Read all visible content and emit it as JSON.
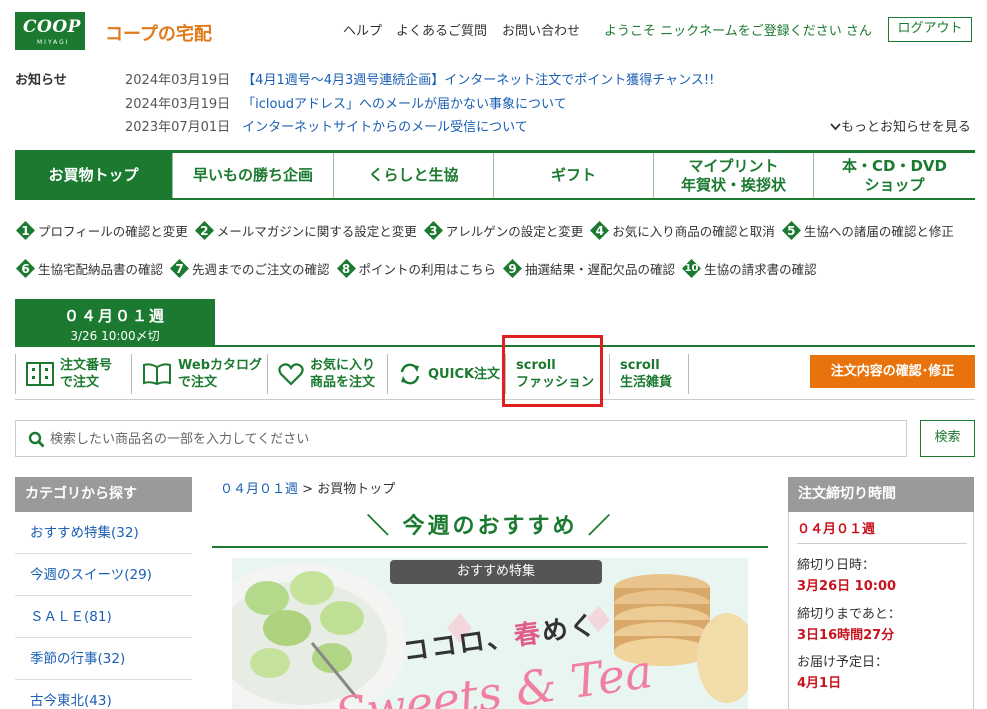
{
  "header": {
    "logo_text": "COOP",
    "logo_sub": "MIYAGI",
    "brand": "コープの宅配",
    "links": [
      "ヘルプ",
      "よくあるご質問",
      "お問い合わせ"
    ],
    "welcome": "ようこそ ニックネームをご登録ください さん",
    "logout": "ログアウト"
  },
  "news": {
    "label": "お知らせ",
    "items": [
      {
        "date": "2024年03月19日",
        "title": "【4月1週号～4月3週号連続企画】インターネット注文でポイント獲得チャンス!!"
      },
      {
        "date": "2024年03月19日",
        "title": "「icloudアドレス」へのメールが届かない事象について"
      },
      {
        "date": "2023年07月01日",
        "title": "インターネットサイトからのメール受信について"
      }
    ],
    "more": "もっとお知らせを見る"
  },
  "mainnav": [
    {
      "line1": "お買物トップ",
      "line2": ""
    },
    {
      "line1": "早いもの勝ち企画",
      "line2": ""
    },
    {
      "line1": "くらしと生協",
      "line2": ""
    },
    {
      "line1": "ギフト",
      "line2": ""
    },
    {
      "line1": "マイプリント",
      "line2": "年賀状・挨拶状"
    },
    {
      "line1": "本・CD・DVD",
      "line2": "ショップ"
    }
  ],
  "steps": [
    {
      "num": "1",
      "label": "プロフィールの確認と変更"
    },
    {
      "num": "2",
      "label": "メールマガジンに関する設定と変更"
    },
    {
      "num": "3",
      "label": "アレルゲンの設定と変更"
    },
    {
      "num": "4",
      "label": "お気に入り商品の確認と取消"
    },
    {
      "num": "5",
      "label": "生協への諸届の確認と修正"
    },
    {
      "num": "6",
      "label": "生協宅配納品書の確認"
    },
    {
      "num": "7",
      "label": "先週までのご注文の確認"
    },
    {
      "num": "8",
      "label": "ポイントの利用はこちら"
    },
    {
      "num": "9",
      "label": "抽選結果・遅配欠品の確認"
    },
    {
      "num": "10",
      "label": "生協の請求書の確認"
    }
  ],
  "week": {
    "title": "０４月０１週",
    "deadline": "3/26 10:00〆切"
  },
  "subnav": [
    {
      "line1": "注文番号",
      "line2": "で注文",
      "icon": "order-number-icon"
    },
    {
      "line1": "Webカタログ",
      "line2": "で注文",
      "icon": "catalog-book-icon"
    },
    {
      "line1": "お気に入り",
      "line2": "商品を注文",
      "icon": "heart-icon"
    },
    {
      "line1": "QUICK注文",
      "line2": "",
      "icon": "refresh-icon"
    },
    {
      "line1": "scroll",
      "line2": "ファッション",
      "icon": ""
    },
    {
      "line1": "scroll",
      "line2": "生活雑貨",
      "icon": ""
    }
  ],
  "order_button": "注文内容の確認･修正",
  "search": {
    "placeholder": "検索したい商品名の一部を入力してください",
    "value": "",
    "button": "検索"
  },
  "sidebar": {
    "header": "カテゴリから探す",
    "items": [
      "おすすめ特集(32)",
      "今週のスイーツ(29)",
      "ＳＡＬＥ(81)",
      "季節の行事(32)",
      "古今東北(43)"
    ]
  },
  "center": {
    "breadcrumb_week": "０４月０１週",
    "breadcrumb_sep": ">",
    "breadcrumb_current": "お買物トップ",
    "section_title": "＼ 今週のおすすめ ／",
    "banner_tag": "おすすめ特集",
    "banner_copy_a": "ココロ、",
    "banner_copy_b": "春",
    "banner_copy_c": "めく",
    "banner_script": "Sweets & Tea"
  },
  "deadline": {
    "header": "注文締切り時間",
    "week": "０４月０１週",
    "close_label": "締切り日時：",
    "close_value": "3月26日 10:00",
    "remaining_label": "締切りまであと：",
    "remaining_value": "3日16時間27分",
    "delivery_label": "お届け予定日：",
    "delivery_value": "4月1日"
  },
  "colors": {
    "green": "#1b7a2f",
    "orange": "#e8730d",
    "link": "#1a5fb4",
    "red": "#c8141e",
    "highlight": "#e02020"
  }
}
